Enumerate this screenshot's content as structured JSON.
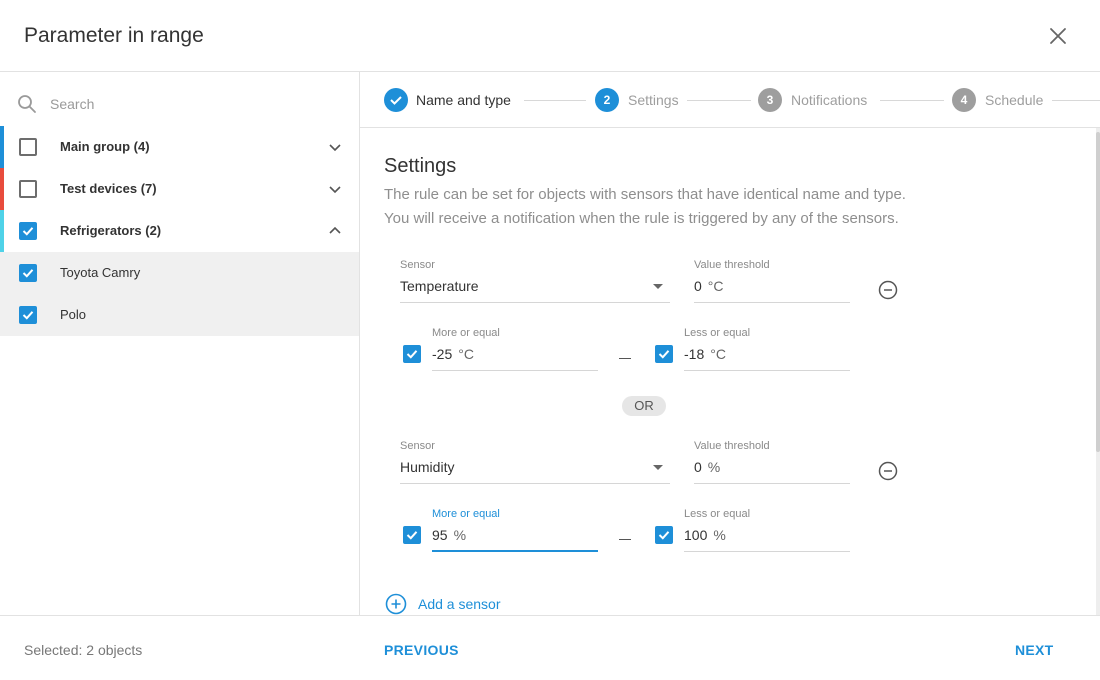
{
  "dialog": {
    "title": "Parameter in range"
  },
  "search": {
    "placeholder": "Search"
  },
  "groups": [
    {
      "label": "Main group (4)",
      "checked": false,
      "color": "#1e8fd8",
      "expanded": false
    },
    {
      "label": "Test devices (7)",
      "checked": false,
      "color": "#e84c3d",
      "expanded": false
    },
    {
      "label": "Refrigerators (2)",
      "checked": true,
      "color": "#4fd2e8",
      "expanded": true
    }
  ],
  "items": [
    {
      "label": "Toyota Camry",
      "checked": true
    },
    {
      "label": "Polo",
      "checked": true
    }
  ],
  "stepper": {
    "steps": [
      {
        "number": "",
        "label": "Name and type",
        "state": "done"
      },
      {
        "number": "2",
        "label": "Settings",
        "state": "active"
      },
      {
        "number": "3",
        "label": "Notifications",
        "state": "todo"
      },
      {
        "number": "4",
        "label": "Schedule",
        "state": "todo"
      }
    ]
  },
  "settings": {
    "title": "Settings",
    "description_1": "The rule can be set for objects with sensors that have identical name and type.",
    "description_2": "You will receive a notification when the rule is triggered by any of the sensors.",
    "or_label": "OR",
    "sensor_label": "Sensor",
    "threshold_label": "Value threshold",
    "more_label": "More or equal",
    "less_label": "Less or equal",
    "sensors": [
      {
        "name": "Temperature",
        "threshold": "0",
        "unit": "°C",
        "more_value": "-25",
        "less_value": "-18",
        "more_checked": true,
        "less_checked": true
      },
      {
        "name": "Humidity",
        "threshold": "0",
        "unit": "%",
        "more_value": "95",
        "less_value": "100",
        "more_checked": true,
        "less_checked": true
      }
    ],
    "add_sensor": "Add a sensor"
  },
  "footer": {
    "selected": "Selected: 2 objects",
    "previous": "PREVIOUS",
    "next": "NEXT"
  },
  "colors": {
    "accent": "#1e8fd8",
    "step_inactive": "#9e9e9e",
    "group_main": "#1e8fd8",
    "group_test": "#e84c3d",
    "group_fridge": "#4fd2e8"
  },
  "icons": {
    "close": "close-icon",
    "search": "search-icon",
    "chevron_down": "chevron-down-icon",
    "chevron_up": "chevron-up-icon",
    "check": "check-icon",
    "minus_circle": "minus-circle-icon",
    "plus_circle": "plus-circle-icon"
  }
}
